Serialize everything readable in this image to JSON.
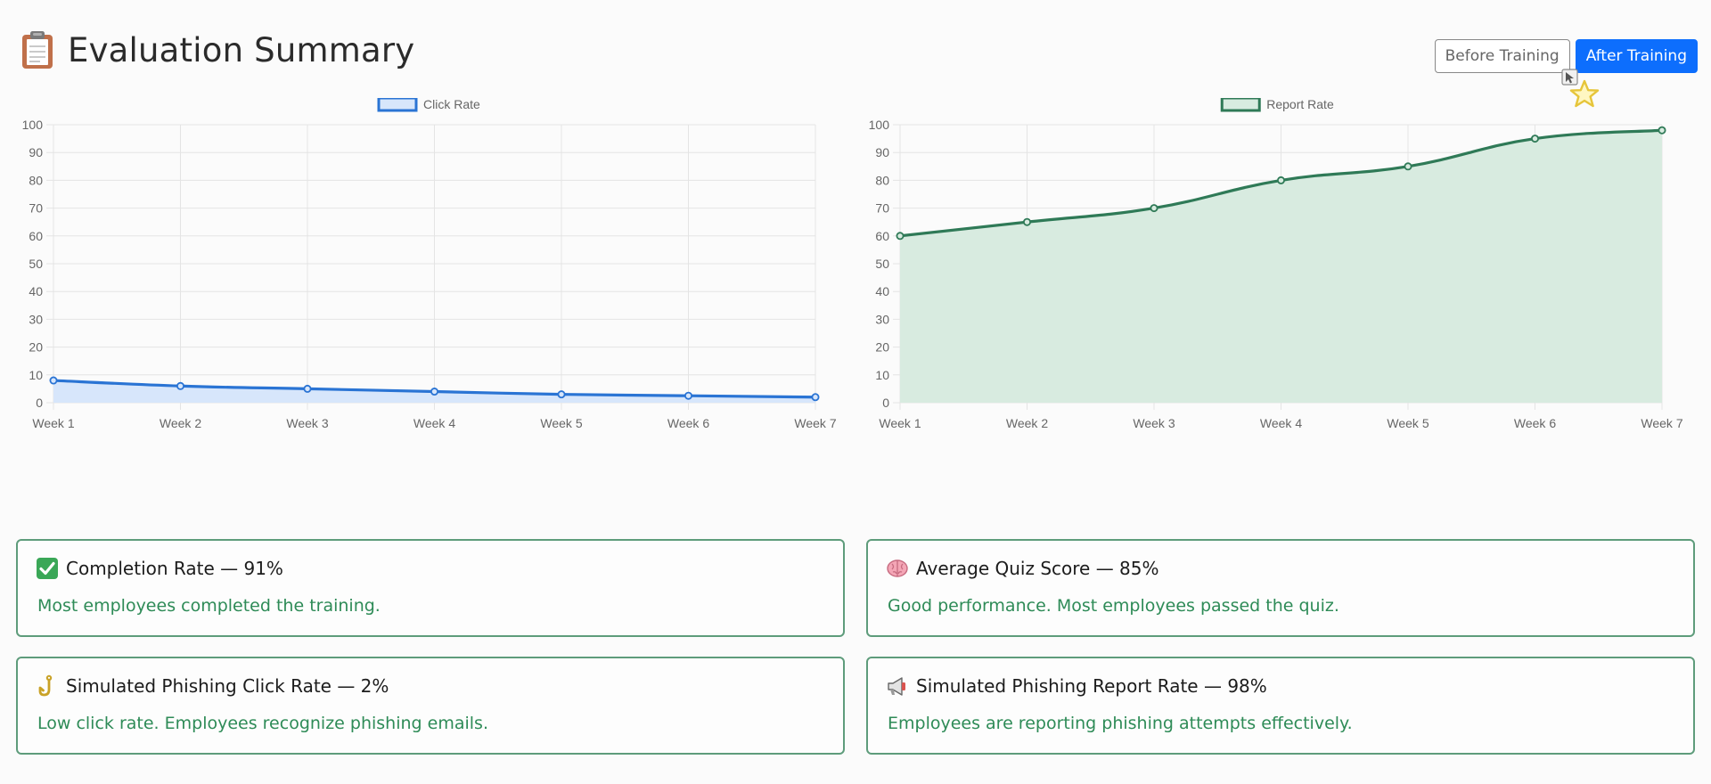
{
  "page": {
    "title": "Evaluation Summary",
    "title_icon": "clipboard-icon"
  },
  "toggle": {
    "before_label": "Before Training",
    "after_label": "After Training",
    "active": "after"
  },
  "colors": {
    "click_line": "#2a74d4",
    "click_fill": "#d7e6fb",
    "report_line": "#2f7a57",
    "report_fill": "#d8ebe0",
    "card_border": "#5e9c7b",
    "card_text": "#2e8b57",
    "primary_button": "#0d6efd"
  },
  "chart_data": [
    {
      "type": "area",
      "series": [
        {
          "name": "Click Rate",
          "values": [
            8,
            6,
            5,
            4,
            3,
            2.5,
            2
          ]
        }
      ],
      "categories": [
        "Week 1",
        "Week 2",
        "Week 3",
        "Week 4",
        "Week 5",
        "Week 6",
        "Week 7"
      ],
      "ylim": [
        0,
        100
      ],
      "yticks": [
        0,
        10,
        20,
        30,
        40,
        50,
        60,
        70,
        80,
        90,
        100
      ],
      "grid": true,
      "legend": "top-center"
    },
    {
      "type": "area",
      "series": [
        {
          "name": "Report Rate",
          "values": [
            60,
            65,
            70,
            80,
            85,
            95,
            98
          ]
        }
      ],
      "categories": [
        "Week 1",
        "Week 2",
        "Week 3",
        "Week 4",
        "Week 5",
        "Week 6",
        "Week 7"
      ],
      "ylim": [
        0,
        100
      ],
      "yticks": [
        0,
        10,
        20,
        30,
        40,
        50,
        60,
        70,
        80,
        90,
        100
      ],
      "grid": true,
      "legend": "top-center"
    }
  ],
  "cards": [
    {
      "icon": "check-mark-icon",
      "title": "Completion Rate — 91%",
      "desc": "Most employees completed the training."
    },
    {
      "icon": "brain-icon",
      "title": "Average Quiz Score — 85%",
      "desc": "Good performance. Most employees passed the quiz."
    },
    {
      "icon": "fishing-hook-icon",
      "title": "Simulated Phishing Click Rate — 2%",
      "desc": "Low click rate. Employees recognize phishing emails."
    },
    {
      "icon": "megaphone-icon",
      "title": "Simulated Phishing Report Rate — 98%",
      "desc": "Employees are reporting phishing attempts effectively."
    }
  ]
}
